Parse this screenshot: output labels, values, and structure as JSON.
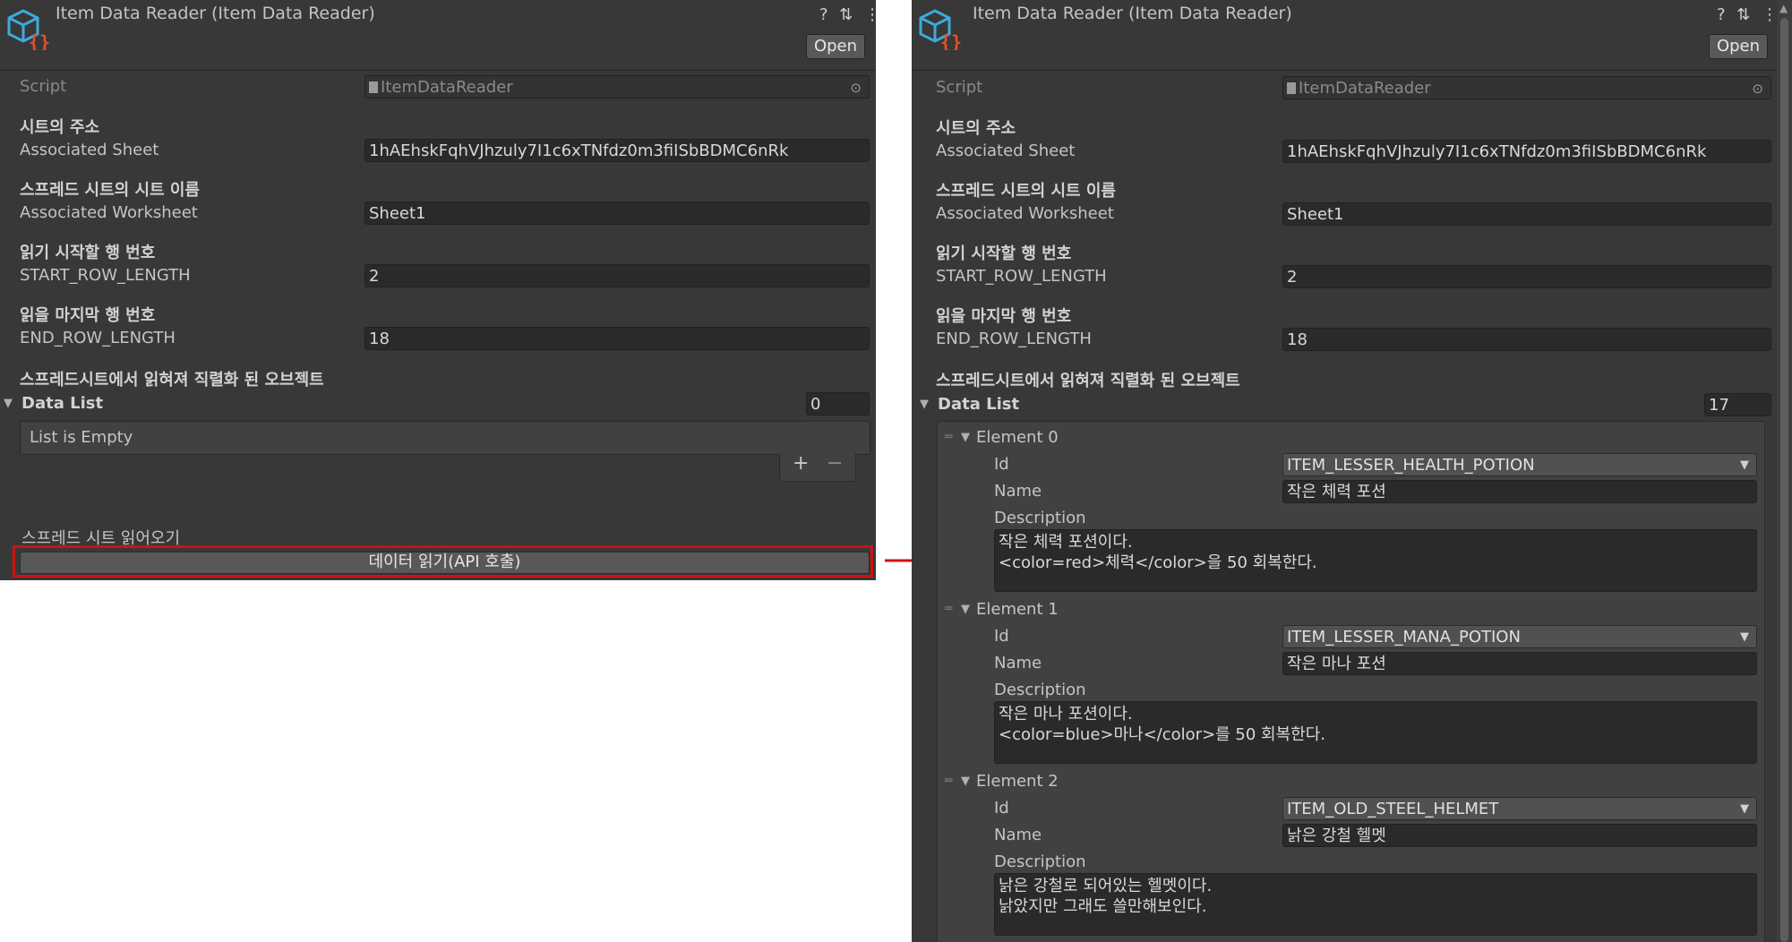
{
  "inspector": {
    "title": "Item Data Reader (Item Data Reader)",
    "open_label": "Open",
    "help_icon": "?",
    "settings_icon": "⇅",
    "menu_icon": "⋮",
    "script_label": "Script",
    "script_value": "ItemDataReader",
    "sheet_kor": "시트의 주소",
    "sheet_label": "Associated Sheet",
    "sheet_value": "1hAEhskFqhVJhzuly7I1c6xTNfdz0m3fiISbBDMC6nRk",
    "worksheet_kor": "스프레드 시트의 시트 이름",
    "worksheet_label": "Associated Worksheet",
    "worksheet_value": "Sheet1",
    "start_kor": "읽기 시작할 행 번호",
    "start_label": "START_ROW_LENGTH",
    "start_value": "2",
    "end_kor": "읽을 마지막 행 번호",
    "end_label": "END_ROW_LENGTH",
    "end_value": "18",
    "list_kor": "스프레드시트에서 읽혀져 직렬화 된 오브젝트",
    "list_label": "Data List"
  },
  "before": {
    "list_count": "0",
    "empty_text": "List is Empty",
    "plus": "+",
    "minus": "−",
    "read_section_label": "스프레드 시트 읽어오기",
    "read_button_label": "데이터 읽기(API 호출)"
  },
  "after": {
    "list_count": "17",
    "field_labels": {
      "id": "Id",
      "name": "Name",
      "description": "Description"
    },
    "elements": [
      {
        "label": "Element 0",
        "id": "ITEM_LESSER_HEALTH_POTION",
        "name": "작은 체력 포션",
        "description": "작은 체력 포션이다.\n<color=red>체력</color>을 50 회복한다."
      },
      {
        "label": "Element 1",
        "id": "ITEM_LESSER_MANA_POTION",
        "name": "작은 마나 포션",
        "description": "작은 마나 포션이다.\n<color=blue>마나</color>를 50 회복한다."
      },
      {
        "label": "Element 2",
        "id": "ITEM_OLD_STEEL_HELMET",
        "name": "낡은 강철 헬멧",
        "description": "낡은 강철로 되어있는 헬멧이다.\n낡았지만 그래도 쓸만해보인다."
      }
    ]
  },
  "colors": {
    "panel_bg": "#383838",
    "highlight": "#d01010",
    "accent_icon": "#3fa9e0",
    "accent_braces": "#e8502a"
  }
}
